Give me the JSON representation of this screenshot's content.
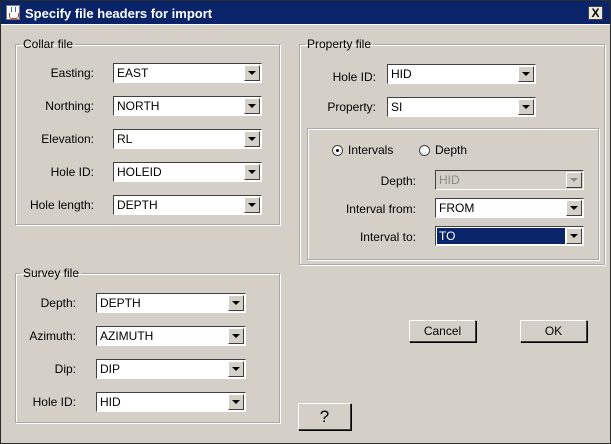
{
  "window": {
    "title": "Specify file headers for import",
    "close_label": "X"
  },
  "collar": {
    "legend": "Collar file",
    "fields": [
      {
        "label": "Easting:",
        "value": "EAST"
      },
      {
        "label": "Northing:",
        "value": "NORTH"
      },
      {
        "label": "Elevation:",
        "value": "RL"
      },
      {
        "label": "Hole ID:",
        "value": "HOLEID"
      },
      {
        "label": "Hole length:",
        "value": "DEPTH"
      }
    ]
  },
  "survey": {
    "legend": "Survey file",
    "fields": [
      {
        "label": "Depth:",
        "value": "DEPTH"
      },
      {
        "label": "Azimuth:",
        "value": "AZIMUTH"
      },
      {
        "label": "Dip:",
        "value": "DIP"
      },
      {
        "label": "Hole ID:",
        "value": "HID"
      }
    ]
  },
  "property": {
    "legend": "Property file",
    "hole_id": {
      "label": "Hole ID:",
      "value": "HID"
    },
    "property": {
      "label": "Property:",
      "value": "SI"
    },
    "mode": {
      "intervals_label": "Intervals",
      "depth_label": "Depth",
      "selected": "Intervals"
    },
    "depth": {
      "label": "Depth:",
      "value": "HID",
      "enabled": false
    },
    "interval_from": {
      "label": "Interval from:",
      "value": "FROM"
    },
    "interval_to": {
      "label": "Interval to:",
      "value": "TO"
    }
  },
  "buttons": {
    "cancel": "Cancel",
    "ok": "OK",
    "help": "?"
  },
  "colors": {
    "titlebar": "#0a246a",
    "background": "#d4d0c8",
    "selection": "#0a246a"
  }
}
